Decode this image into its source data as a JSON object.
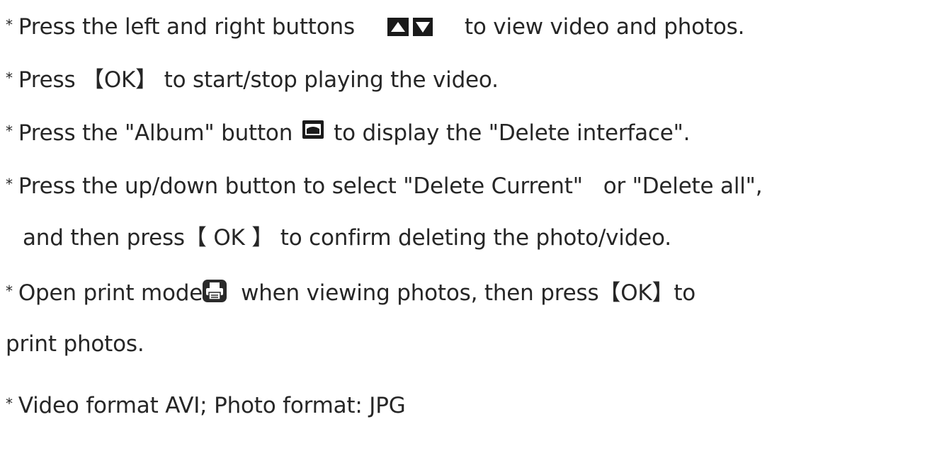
{
  "bullet": "*",
  "lines": {
    "nav": {
      "prefix": "Press the left and right buttons",
      "suffix": "to view video and photos.",
      "icons": [
        "up-arrow-button-icon",
        "down-arrow-button-icon"
      ]
    },
    "play": {
      "text": "Press 【OK】 to start/stop playing the video."
    },
    "album": {
      "prefix": "Press the \"Album\" button",
      "suffix": "to display the \"Delete interface\".",
      "icon": "album-button-icon"
    },
    "select": {
      "text": "Press the up/down button to select \"Delete Current\"   or \"Delete all\","
    },
    "confirm": {
      "text": "and then press【 OK 】 to confirm deleting the photo/video."
    },
    "print": {
      "prefix": "Open print mode",
      "suffix": "when viewing photos, then press【OK】to",
      "continuation": "print photos.",
      "icon": "printer-icon"
    },
    "format": {
      "text": "Video format AVI; Photo format: JPG"
    }
  },
  "colors": {
    "text": "#262626",
    "icon": "#1a1a1a",
    "printer_icon_bg": "#2a2a2a"
  }
}
